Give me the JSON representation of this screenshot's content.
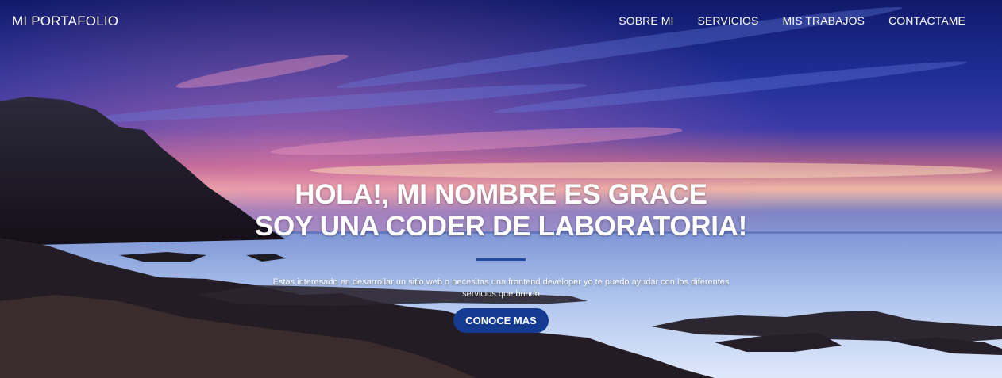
{
  "navbar": {
    "brand": "MI PORTAFOLIO",
    "links": [
      "SOBRE MI",
      "SERVICIOS",
      "MIS TRABAJOS",
      "CONTACTAME"
    ]
  },
  "hero": {
    "headline_line1": "HOLA!, MI NOMBRE ES GRACE",
    "headline_line2": "SOY UNA CODER DE LABORATORIA!",
    "subtext": "Estas interesado en desarrollar un sitio web o necesitas una frontend developer yo te puedo ayudar con los diferentes servicios que brindo",
    "cta_label": "CONOCE MAS"
  },
  "colors": {
    "accent": "#1f4ba3",
    "button": "#153a92",
    "text": "#ffffff"
  }
}
